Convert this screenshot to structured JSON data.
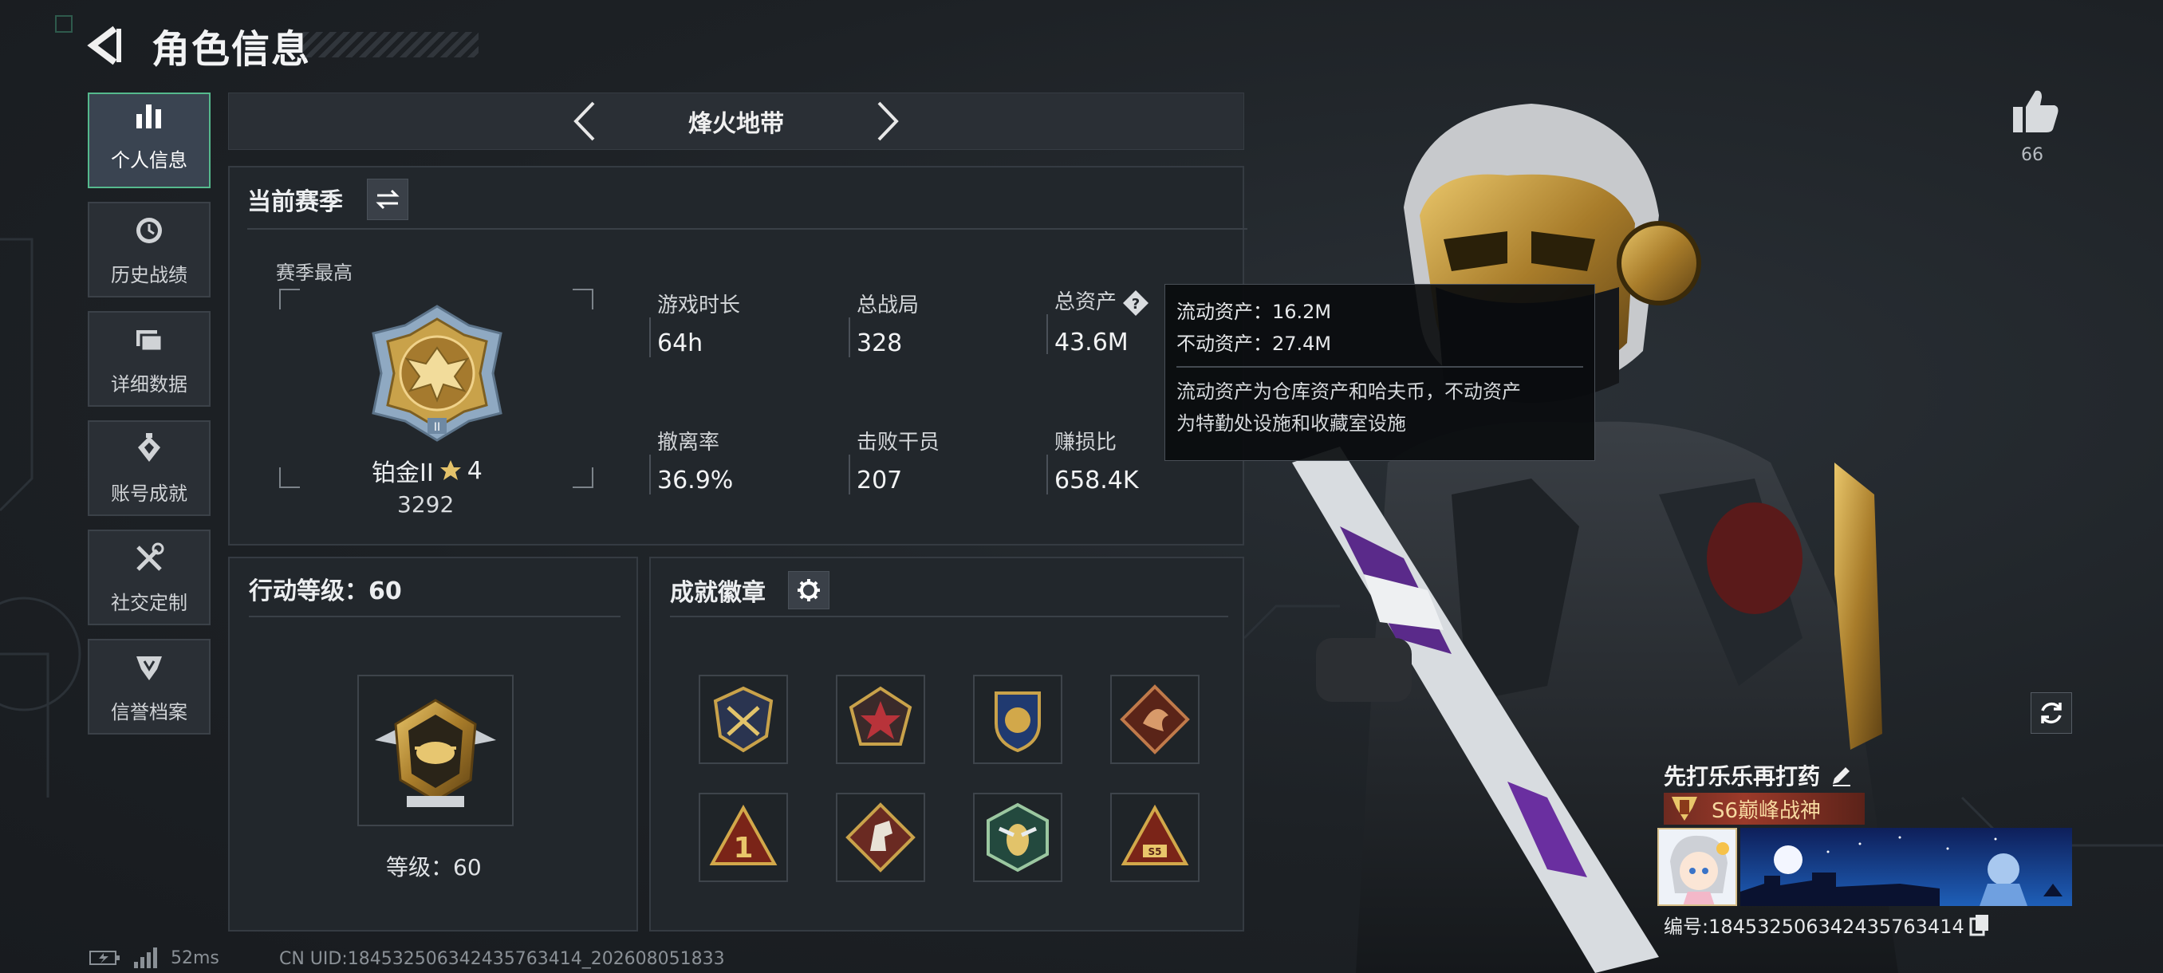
{
  "header": {
    "title": "角色信息"
  },
  "sidebar": {
    "items": [
      {
        "label": "个人信息",
        "icon": "bar-chart-icon",
        "active": true
      },
      {
        "label": "历史战绩",
        "icon": "clock-icon"
      },
      {
        "label": "详细数据",
        "icon": "folder-icon"
      },
      {
        "label": "账号成就",
        "icon": "achievement-icon"
      },
      {
        "label": "社交定制",
        "icon": "tools-icon"
      },
      {
        "label": "信誉档案",
        "icon": "reputation-icon"
      }
    ]
  },
  "mode": {
    "name": "烽火地带"
  },
  "season": {
    "title": "当前赛季",
    "best_label": "赛季最高",
    "rank_name": "铂金II",
    "rank_stars": "4",
    "rank_score": "3292",
    "stats": [
      {
        "label": "游戏时长",
        "value": "64h"
      },
      {
        "label": "总战局",
        "value": "328"
      },
      {
        "label": "总资产",
        "value": "43.6M"
      },
      {
        "label": "撤离率",
        "value": "36.9%"
      },
      {
        "label": "击败干员",
        "value": "207"
      },
      {
        "label": "赚损比",
        "value": "658.4K"
      }
    ]
  },
  "tooltip": {
    "liquid": "流动资产：16.2M",
    "fixed": "不动资产：27.4M",
    "desc1": "流动资产为仓库资产和哈夫币，不动资产",
    "desc2": "为特勤处设施和收藏室设施"
  },
  "level_panel": {
    "title": "行动等级：60",
    "level_text": "等级：60"
  },
  "badges_panel": {
    "title": "成就徽章"
  },
  "status": {
    "ping": "52ms",
    "uid": "CN UID:184532506342435763414_202608051833"
  },
  "like": {
    "count": "66"
  },
  "player": {
    "name": "先打乐乐再打药",
    "title": "S6巅峰战神",
    "id": "编号:184532506342435763414"
  },
  "colors": {
    "accent_green": "#55b98d",
    "gold": "#c9a24a",
    "bg": "#1d2125"
  }
}
